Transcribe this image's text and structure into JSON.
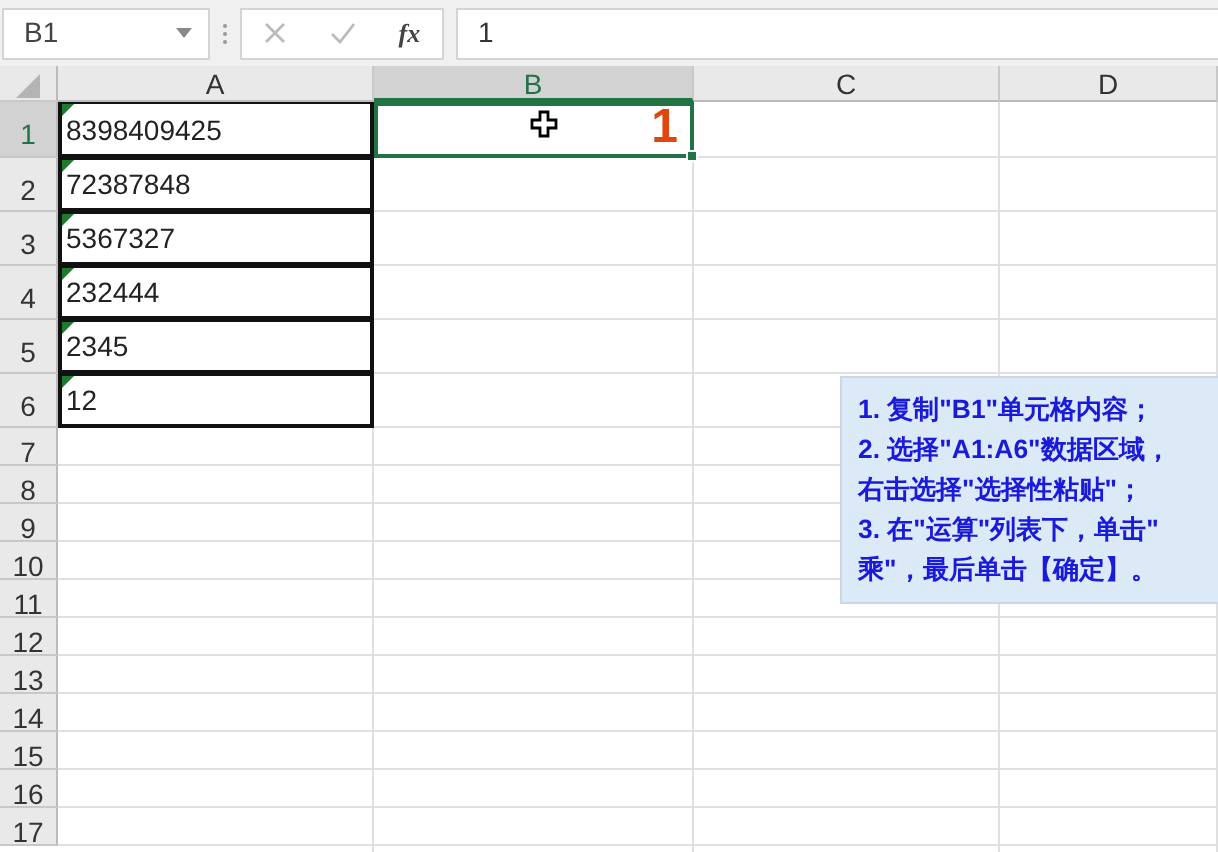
{
  "formula_bar": {
    "name_box": "B1",
    "function_label": "fx",
    "formula": "1",
    "cancel_disabled": true,
    "enter_disabled": true
  },
  "columns": [
    {
      "label": "A",
      "selected": false
    },
    {
      "label": "B",
      "selected": true
    },
    {
      "label": "C",
      "selected": false
    },
    {
      "label": "D",
      "selected": false
    }
  ],
  "rows": [
    {
      "label": "1",
      "selected": true,
      "cells": [
        {
          "text": "8398409425",
          "flag": true,
          "bordered": true,
          "selected": false
        },
        {
          "text": "1",
          "flag": false,
          "bordered": false,
          "selected": true
        }
      ]
    },
    {
      "label": "2",
      "selected": false,
      "cells": [
        {
          "text": "72387848",
          "flag": true,
          "bordered": true,
          "selected": false
        }
      ]
    },
    {
      "label": "3",
      "selected": false,
      "cells": [
        {
          "text": "5367327",
          "flag": true,
          "bordered": true,
          "selected": false
        }
      ]
    },
    {
      "label": "4",
      "selected": false,
      "cells": [
        {
          "text": "232444",
          "flag": true,
          "bordered": true,
          "selected": false
        }
      ]
    },
    {
      "label": "5",
      "selected": false,
      "cells": [
        {
          "text": "2345",
          "flag": true,
          "bordered": true,
          "selected": false
        }
      ]
    },
    {
      "label": "6",
      "selected": false,
      "cells": [
        {
          "text": "12",
          "flag": true,
          "bordered": true,
          "selected": false
        }
      ]
    },
    {
      "label": "7",
      "selected": false,
      "cells": []
    },
    {
      "label": "8",
      "selected": false,
      "cells": []
    },
    {
      "label": "9",
      "selected": false,
      "cells": []
    },
    {
      "label": "10",
      "selected": false,
      "cells": []
    },
    {
      "label": "11",
      "selected": false,
      "cells": []
    },
    {
      "label": "12",
      "selected": false,
      "cells": []
    },
    {
      "label": "13",
      "selected": false,
      "cells": []
    },
    {
      "label": "14",
      "selected": false,
      "cells": []
    },
    {
      "label": "15",
      "selected": false,
      "cells": []
    },
    {
      "label": "16",
      "selected": false,
      "cells": []
    },
    {
      "label": "17",
      "selected": false,
      "cells": []
    }
  ],
  "note": {
    "lines": [
      "1. 复制\"B1\"单元格内容；",
      "2. 选择\"A1:A6\"数据区域，",
      "右击选择\"选择性粘贴\"；",
      "3. 在\"运算\"列表下，单击\"",
      "乘\"，最后单击【确定】。"
    ]
  }
}
